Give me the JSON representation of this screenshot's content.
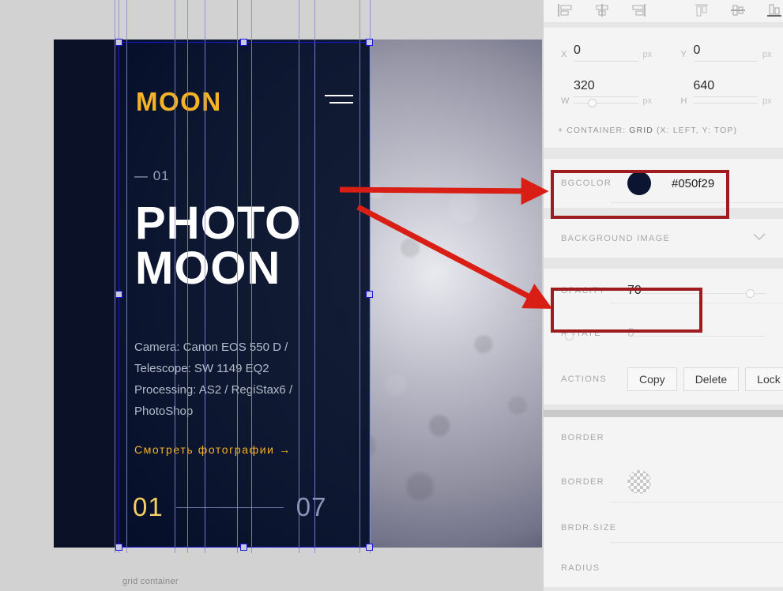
{
  "canvas": {
    "grid_container_label": "grid container",
    "design": {
      "logo": "MOON",
      "menu_icon": "hamburger-menu-icon",
      "slide_index": "— 01",
      "title_line1": "PHOTO",
      "title_line2": "MOON",
      "meta": "Camera: Canon EOS 550 D / Telescope: SW 1149 EQ2 Processing: AS2 / RegiStax6 / PhotoShop",
      "meta_lines": [
        "Camera: Canon EOS 550 D /",
        "Telescope: SW 1149 EQ2",
        "Processing: AS2 / RegiStax6 /",
        "PhotoShop"
      ],
      "cta": "Смотреть фотографии →",
      "pager_current": "01",
      "pager_total": "07",
      "accent_color": "#f5b325",
      "background_color": "#050f29"
    }
  },
  "panel": {
    "align_tools": {
      "group1": [
        "align-left-icon",
        "align-center-horizontal-icon",
        "align-right-icon"
      ],
      "group2": [
        "align-top-icon",
        "align-middle-vertical-icon",
        "align-bottom-icon"
      ]
    },
    "position": {
      "x_label": "X",
      "x_value": "0",
      "x_unit": "px",
      "y_label": "Y",
      "y_value": "0",
      "y_unit": "px",
      "w_label": "W",
      "w_value": "320",
      "w_unit": "px",
      "h_label": "H",
      "h_value": "640",
      "h_unit": "px"
    },
    "container_note_prefix": "CONTAINER:",
    "container_note_value": "GRID",
    "container_note_suffix": "(X: LEFT, Y: TOP)",
    "bgcolor": {
      "label": "BGCOLOR",
      "value": "#050f29",
      "swatch": "#0b1430"
    },
    "background_image": {
      "label": "BACKGROUND IMAGE",
      "chevron": "chevron-down-icon"
    },
    "opacity": {
      "label": "OPACITY",
      "value": "70"
    },
    "rotate": {
      "label": "ROTATE",
      "value": "0"
    },
    "actions": {
      "label": "ACTIONS",
      "buttons": [
        "Copy",
        "Delete",
        "Lock"
      ]
    },
    "border_section": {
      "label": "BORDER"
    },
    "border_color": {
      "label": "BORDER"
    },
    "border_size": {
      "label": "BRDR.SIZE"
    },
    "radius": {
      "label": "RADIUS"
    }
  },
  "annotations": {
    "highlight_color": "#9e1b20",
    "arrow_color": "#d91f15",
    "arrow1_target": "bgcolor-field",
    "arrow2_target": "opacity-field"
  }
}
